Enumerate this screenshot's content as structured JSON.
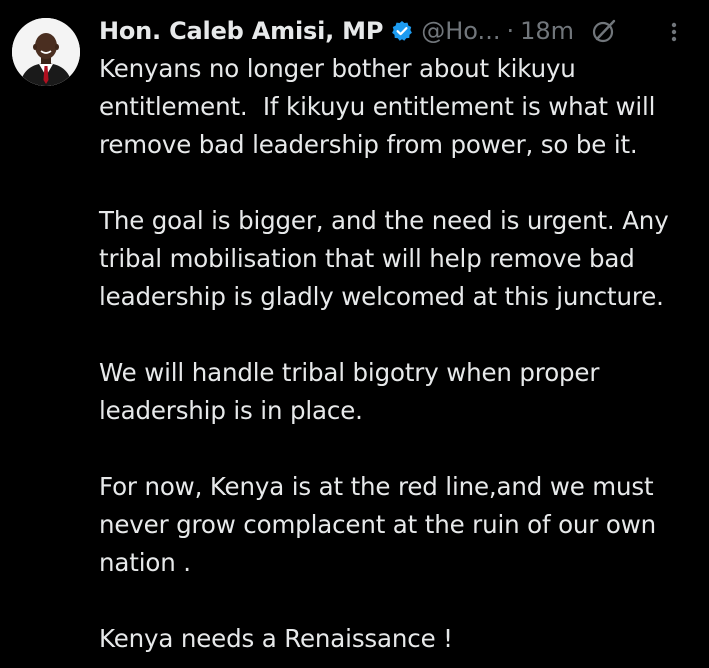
{
  "tweet": {
    "author_name": "Hon. Caleb Amisi, MP",
    "handle": "@Ho...",
    "separator": "·",
    "time": "18m",
    "paragraphs": [
      "Kenyans no longer bother about kikuyu entitlement.  If kikuyu entitlement is what will remove bad leadership from power, so be it.",
      "The goal is bigger, and the need is urgent. Any tribal mobilisation that will help remove bad leadership is gladly welcomed at this juncture.",
      "We will handle tribal bigotry when proper leadership is in place.",
      "For now, Kenya is at the red line,and we must never grow complacent at the ruin of our own nation .",
      "Kenya needs a Renaissance !"
    ]
  },
  "icons": {
    "verified": "verified-badge-icon",
    "grok": "grok-icon",
    "more": "more-options-icon"
  },
  "colors": {
    "background": "#000000",
    "text": "#e7e9ea",
    "secondary": "#71767b",
    "verified_blue": "#1d9bf0"
  }
}
